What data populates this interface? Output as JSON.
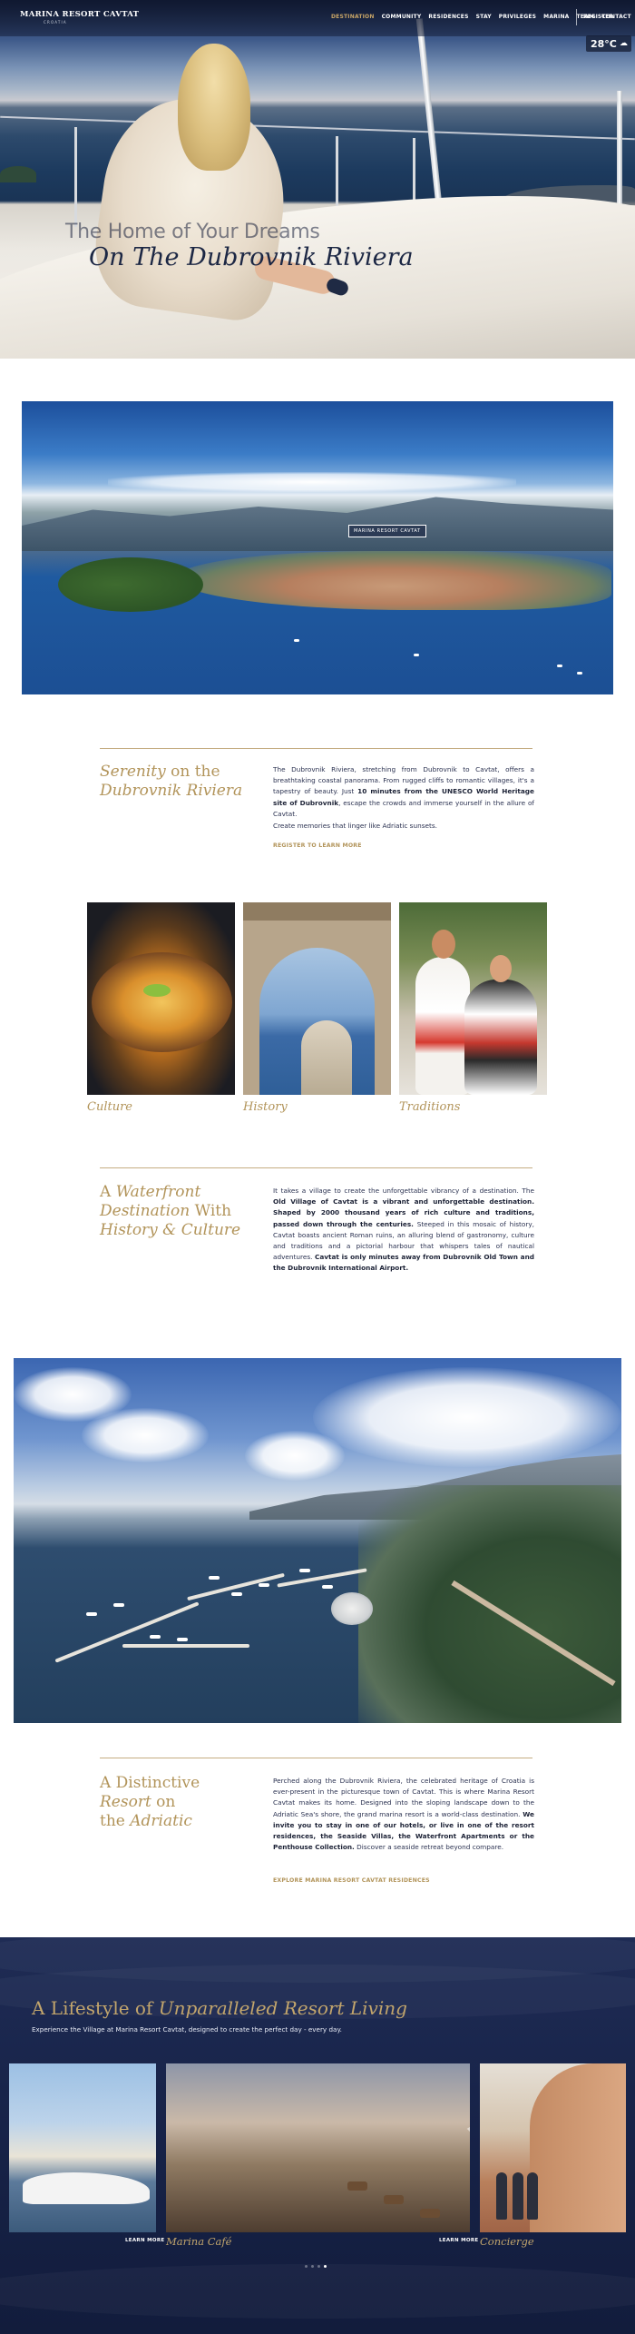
{
  "header": {
    "logo": "MARINA RESORT CAVTAT",
    "logo_sub": "CROATIA",
    "menu": [
      "DESTINATION",
      "COMMUNITY",
      "RESIDENCES",
      "STAY",
      "PRIVILEGES",
      "MARINA",
      "TEAM",
      "CONTACT"
    ],
    "active_item": "DESTINATION",
    "register": "REGISTER"
  },
  "weather": {
    "temperature": "28°C",
    "icon": "cloud-icon"
  },
  "hero": {
    "line1": "The Home of Your Dreams",
    "line2": "On The Dubrovnik Riviera"
  },
  "aerial_pin": "MARINA RESORT CAVTAT",
  "serenity": {
    "heading_a": "Serenity",
    "heading_b": " on the",
    "heading_c": "Dubrovnik Riviera",
    "p1_a": "The Dubrovnik Riviera, stretching from Dubrovnik to Cavtat, offers a breathtaking coastal panorama. From rugged cliffs to romantic villages, it's a tapestry of beauty. Just ",
    "p1_b": "10 minutes from the UNESCO World Heritage site of Dubrovnik",
    "p1_c": ", escape the crowds and immerse yourself in the allure of Cavtat.",
    "p2": "Create memories that linger like Adriatic sunsets.",
    "cta": "REGISTER TO LEARN MORE"
  },
  "tiles": [
    "Culture",
    "History",
    "Traditions"
  ],
  "waterfront": {
    "heading_a": "A ",
    "heading_b": "Waterfront",
    "heading_c": "Destination",
    "heading_d": " With",
    "heading_e": "History & Culture",
    "p_a": "It takes a village to create the unforgettable vibrancy of a destination. The ",
    "p_b": "Old Village of Cavtat is a vibrant and unforgettable destination. Shaped by 2000 thousand years of rich culture and traditions, passed down through the centuries.",
    "p_c": " Steeped in this mosaic of history, Cavtat boasts ancient Roman ruins, an alluring blend of gastronomy, culture and traditions and a pictorial harbour that whispers tales of nautical adventures. ",
    "p_d": "Cavtat is only minutes away from Dubrovnik Old Town and the Dubrovnik International Airport."
  },
  "distinctive": {
    "heading_a": "A Distinctive",
    "heading_b": "Resort",
    "heading_c": " on",
    "heading_d": "the ",
    "heading_e": "Adriatic",
    "p_a": "Perched along the Dubrovnik Riviera, the celebrated heritage of Croatia is ever-present in the picturesque town of Cavtat. This is where Marina Resort Cavtat makes its home. Designed into the sloping landscape down to the Adriatic Sea's shore, the grand marina resort is a world-class destination. ",
    "p_b": "We invite you to stay in one of our hotels, or live in one of the resort residences, the Seaside Villas, the Waterfront Apartments or the Penthouse Collection.",
    "p_c": " Discover a seaside retreat beyond compare.",
    "cta": "EXPLORE MARINA RESORT CAVTAT RESIDENCES"
  },
  "lifestyle": {
    "title_a": "A Lifestyle of ",
    "title_b": "Unparalleled Resort Living",
    "subtitle": "Experience the Village at Marina Resort Cavtat, designed to create the perfect day - every day.",
    "cards": [
      {
        "link": "LEARN MORE",
        "label": "Marina Café"
      },
      {
        "link": "LEARN MORE",
        "label": "Concierge"
      }
    ],
    "dot_count": 4,
    "active_dot": 3
  }
}
